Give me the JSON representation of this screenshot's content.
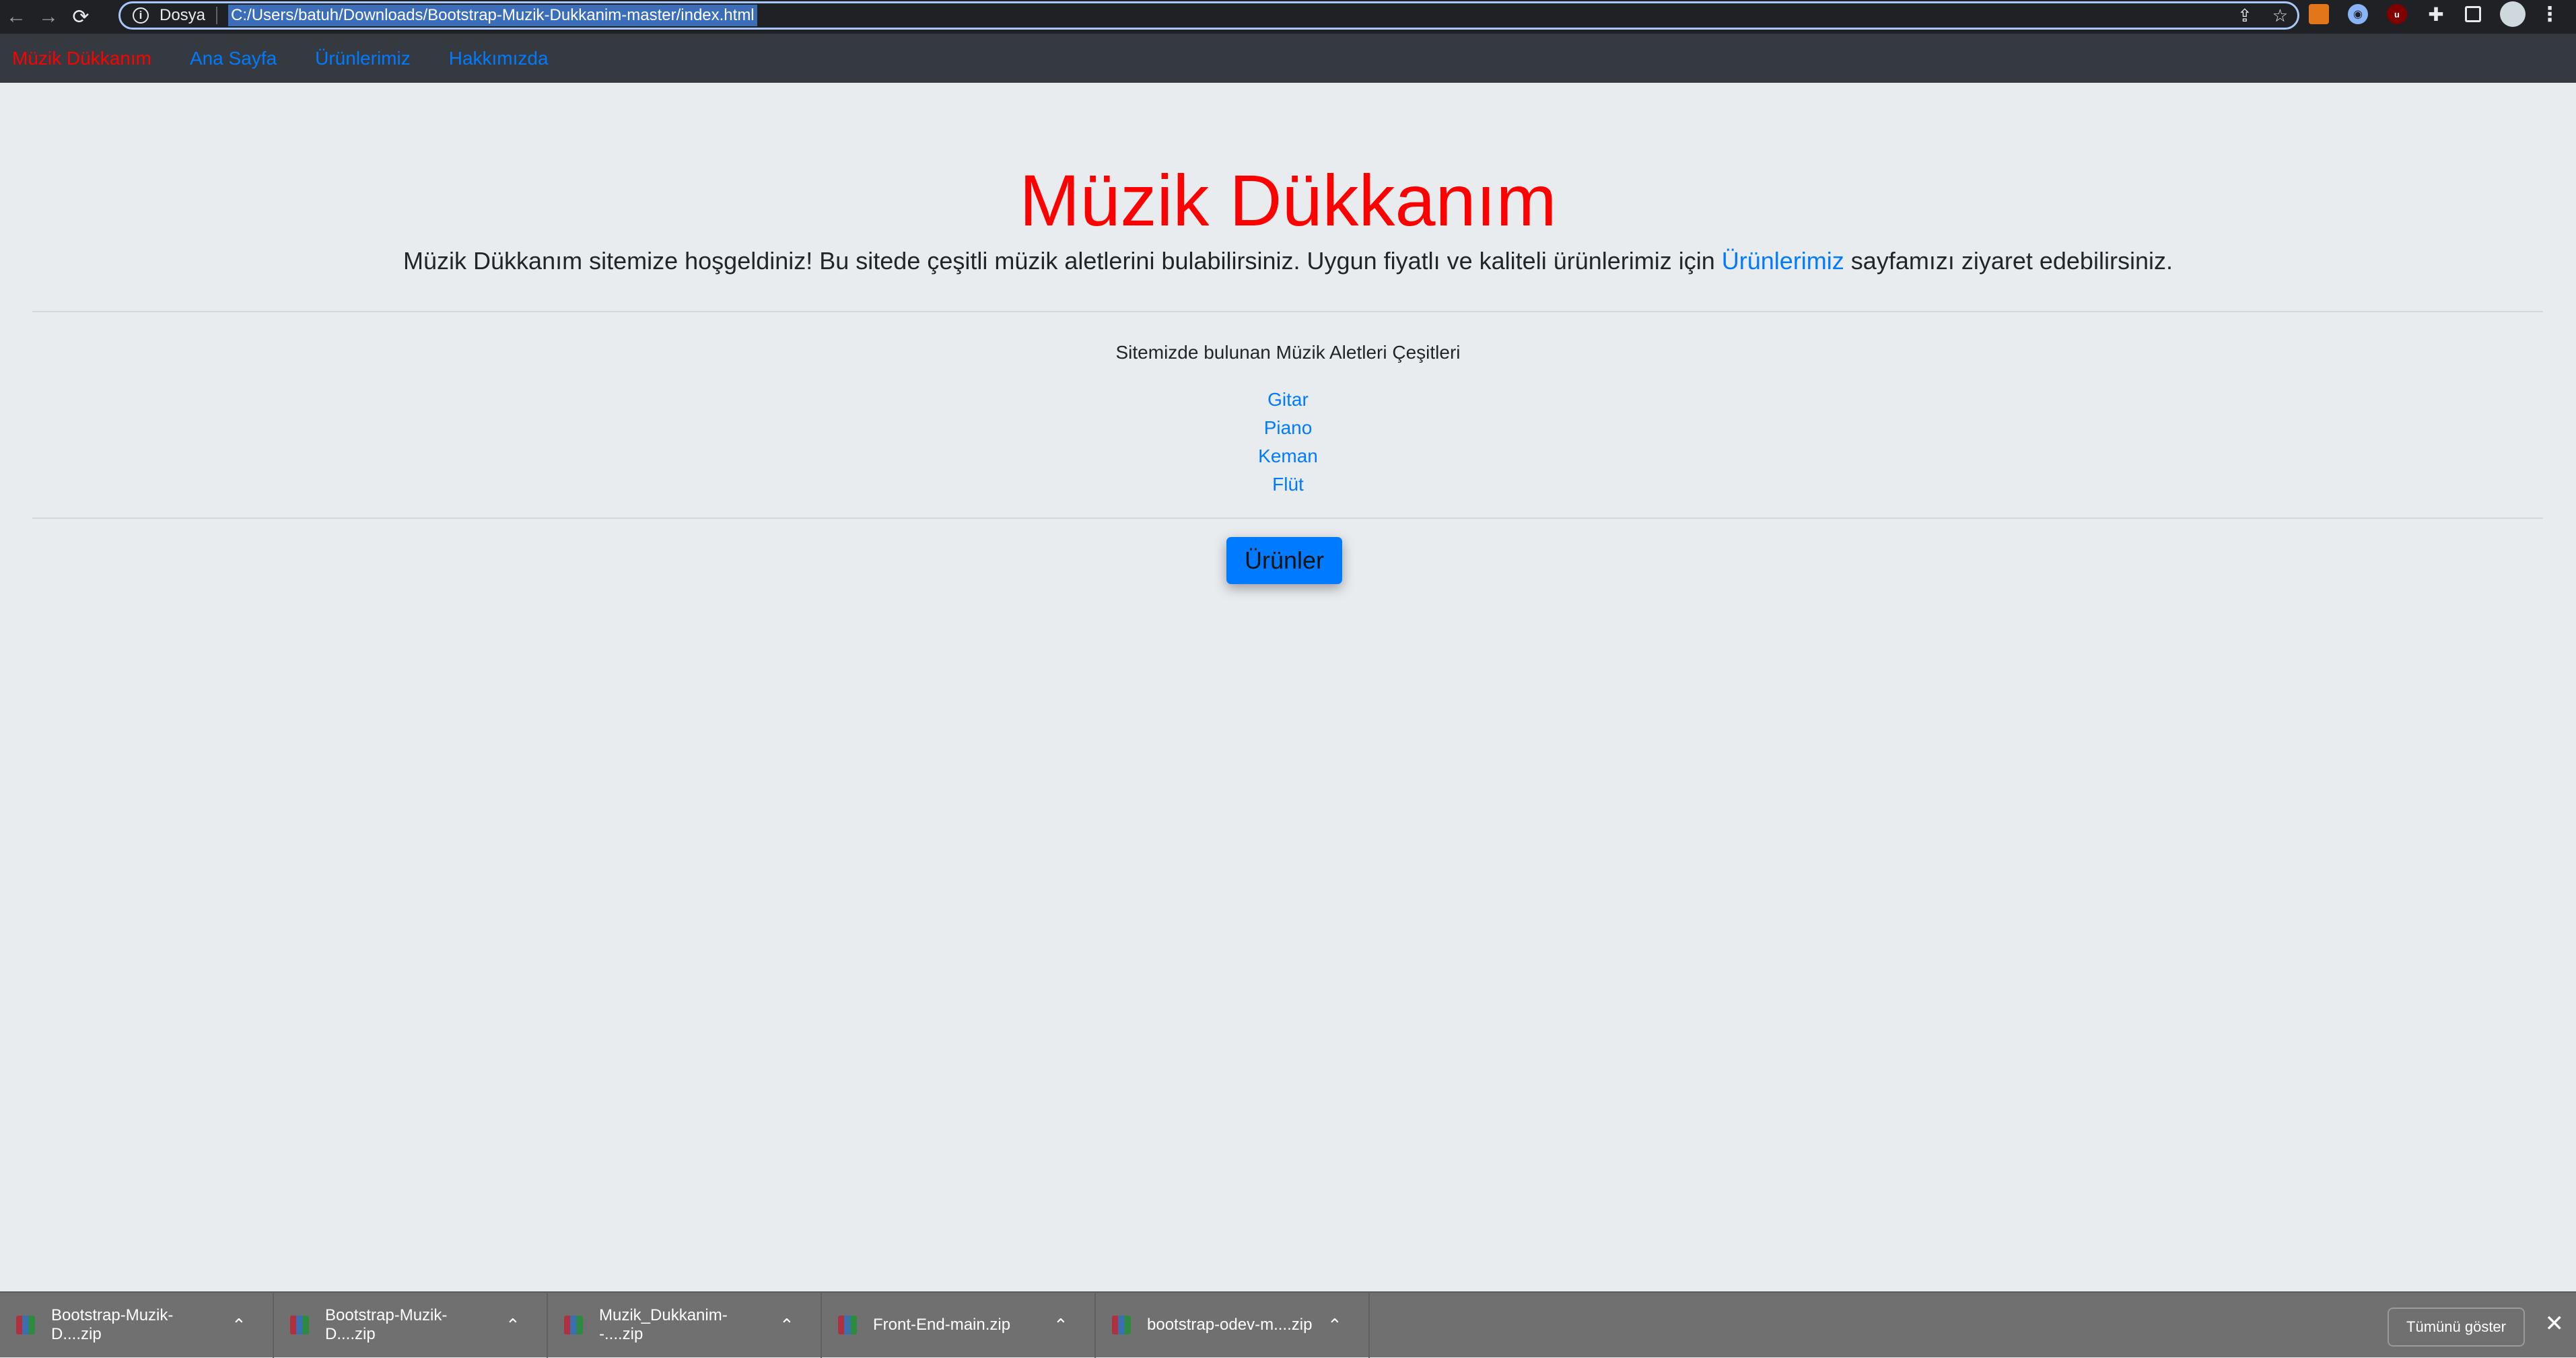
{
  "browser": {
    "scheme_label": "Dosya",
    "url": "C:/Users/batuh/Downloads/Bootstrap-Muzik-Dukkanim-master/index.html"
  },
  "navbar": {
    "brand": "Müzik Dükkanım",
    "links": [
      "Ana Sayfa",
      "Ürünlerimiz",
      "Hakkımızda"
    ]
  },
  "jumbotron": {
    "title": "Müzik Dükkanım",
    "lead_before": "Müzik Dükkanım sitemize hoşgeldiniz! Bu sitede çeşitli müzik aletlerini bulabilirsiniz. Uygun fiyatlı ve kaliteli ürünlerimiz için ",
    "lead_link": "Ürünlerimiz",
    "lead_after": " sayfamızı ziyaret edebilirsiniz.",
    "subtitle": "Sitemizde bulunan Müzik Aletleri Çeşitleri",
    "instruments": [
      "Gitar",
      "Piano",
      "Keman",
      "Flüt"
    ],
    "button": "Ürünler"
  },
  "downloads": {
    "items": [
      "Bootstrap-Muzik-D....zip",
      "Bootstrap-Muzik-D....zip",
      "Muzik_Dukkanim--....zip",
      "Front-End-main.zip",
      "bootstrap-odev-m....zip"
    ],
    "show_all": "Tümünü göster"
  },
  "icons": [
    "back-arrow-icon",
    "forward-arrow-icon",
    "reload-icon",
    "info-icon",
    "share-icon",
    "star-icon",
    "extension-icons",
    "puzzle-icon",
    "side-panel-icon",
    "profile-avatar",
    "menu-icon",
    "chevron-up-icon",
    "close-icon"
  ]
}
